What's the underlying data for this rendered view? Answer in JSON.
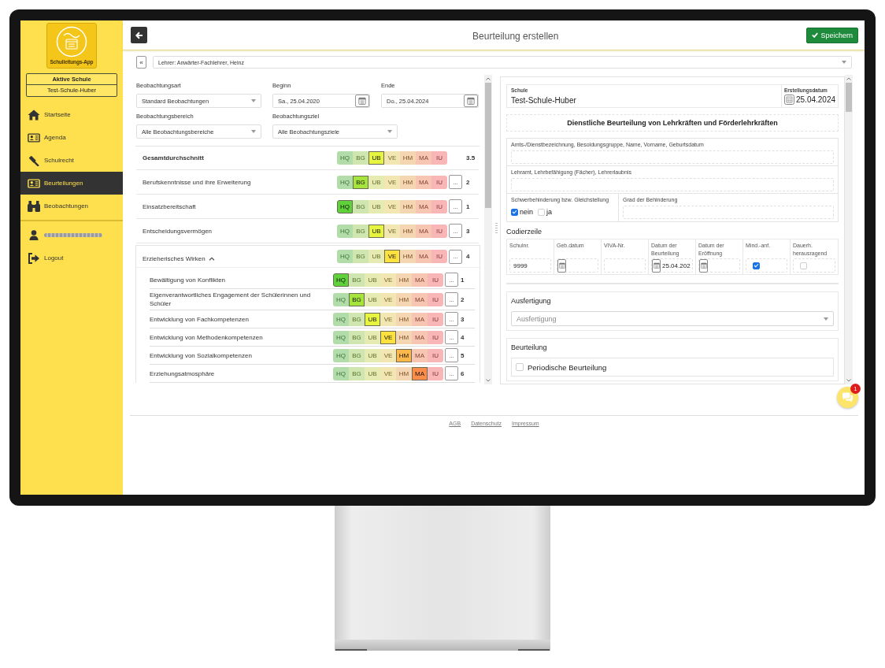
{
  "sidebar": {
    "logo_caption": "Schulleitungs-App",
    "active_school": {
      "heading": "Aktive Schule",
      "name": "Test-Schule-Huber"
    },
    "nav": [
      {
        "label": "Startseite",
        "selected": false
      },
      {
        "label": "Agenda",
        "selected": false
      },
      {
        "label": "Schulrecht",
        "selected": false
      },
      {
        "label": "Beurteilungen",
        "selected": true
      },
      {
        "label": "Beobachtungen",
        "selected": false
      }
    ],
    "logout": "Logout"
  },
  "topbar": {
    "title": "Beurteilung erstellen",
    "save_button": "Speichern"
  },
  "teacher_bar": {
    "collapse_button": "«",
    "teacher": "Lehrer: Anwärter-Fachlehrer, Heinz"
  },
  "filter_rows": [
    {
      "fields": [
        {
          "kind": "select",
          "label": "Beobachtungsart",
          "value": "Standard Beobachtungen"
        },
        {
          "kind": "date",
          "label": "Beginn",
          "value": "Sa., 25.04.2020"
        },
        {
          "kind": "date",
          "label": "Ende",
          "value": "Do., 25.04.2024"
        }
      ]
    },
    {
      "fields": [
        {
          "kind": "select",
          "label": "Beobachtungsbereich",
          "value": "Alle Beobachtungsbereiche"
        },
        {
          "kind": "select",
          "label": "Beobachtungsziel",
          "value": "Alle Beobachtungsziele"
        }
      ]
    }
  ],
  "ratings": [
    {
      "kind": "average",
      "label": "Gesamtdurchschnitt",
      "grades": [
        {
          "label": "HQ",
          "selected": false
        },
        {
          "label": "BG",
          "selected": false
        },
        {
          "label": "UB",
          "selected": true
        },
        {
          "label": "VE",
          "selected": false
        },
        {
          "label": "HM",
          "selected": false
        },
        {
          "label": "MA",
          "selected": false
        },
        {
          "label": "IU",
          "selected": false
        }
      ],
      "value": "3.5"
    },
    {
      "kind": "criterion",
      "label": "Berufskenntnisse und ihre Erweiterung",
      "grades": [
        {
          "label": "HQ",
          "selected": false
        },
        {
          "label": "BG",
          "selected": true
        },
        {
          "label": "UB",
          "selected": false
        },
        {
          "label": "VE",
          "selected": false
        },
        {
          "label": "HM",
          "selected": false
        },
        {
          "label": "MA",
          "selected": false
        },
        {
          "label": "IU",
          "selected": false
        }
      ],
      "more": "...",
      "value": "2"
    },
    {
      "kind": "criterion",
      "label": "Einsatzbereitschaft",
      "grades": [
        {
          "label": "HQ",
          "selected": true
        },
        {
          "label": "BG",
          "selected": false
        },
        {
          "label": "UB",
          "selected": false
        },
        {
          "label": "VE",
          "selected": false
        },
        {
          "label": "HM",
          "selected": false
        },
        {
          "label": "MA",
          "selected": false
        },
        {
          "label": "IU",
          "selected": false
        }
      ],
      "more": "...",
      "value": "1"
    },
    {
      "kind": "criterion",
      "label": "Entscheidungsvermögen",
      "grades": [
        {
          "label": "HQ",
          "selected": false
        },
        {
          "label": "BG",
          "selected": false
        },
        {
          "label": "UB",
          "selected": true
        },
        {
          "label": "VE",
          "selected": false
        },
        {
          "label": "HM",
          "selected": false
        },
        {
          "label": "MA",
          "selected": false
        },
        {
          "label": "IU",
          "selected": false
        }
      ],
      "more": "...",
      "value": "3"
    },
    {
      "kind": "group",
      "label": "Erzieherisches Wirken",
      "expanded": true,
      "grades": [
        {
          "label": "HQ",
          "selected": false
        },
        {
          "label": "BG",
          "selected": false
        },
        {
          "label": "UB",
          "selected": false
        },
        {
          "label": "VE",
          "selected": true
        },
        {
          "label": "HM",
          "selected": false
        },
        {
          "label": "MA",
          "selected": false
        },
        {
          "label": "IU",
          "selected": false
        }
      ],
      "more": "...",
      "value": "4",
      "children": [
        {
          "kind": "criterion",
          "label": "Bewältigung von Konflikten",
          "grades": [
            {
              "label": "HQ",
              "selected": true
            },
            {
              "label": "BG",
              "selected": false
            },
            {
              "label": "UB",
              "selected": false
            },
            {
              "label": "VE",
              "selected": false
            },
            {
              "label": "HM",
              "selected": false
            },
            {
              "label": "MA",
              "selected": false
            },
            {
              "label": "IU",
              "selected": false
            }
          ],
          "more": "...",
          "value": "1"
        },
        {
          "kind": "criterion",
          "label": "Eigenverantwortliches Engagement der Schülerinnen und Schüler",
          "grades": [
            {
              "label": "HQ",
              "selected": false
            },
            {
              "label": "BG",
              "selected": true
            },
            {
              "label": "UB",
              "selected": false
            },
            {
              "label": "VE",
              "selected": false
            },
            {
              "label": "HM",
              "selected": false
            },
            {
              "label": "MA",
              "selected": false
            },
            {
              "label": "IU",
              "selected": false
            }
          ],
          "more": "...",
          "value": "2"
        },
        {
          "kind": "criterion",
          "label": "Entwicklung von Fachkompetenzen",
          "grades": [
            {
              "label": "HQ",
              "selected": false
            },
            {
              "label": "BG",
              "selected": false
            },
            {
              "label": "UB",
              "selected": true
            },
            {
              "label": "VE",
              "selected": false
            },
            {
              "label": "HM",
              "selected": false
            },
            {
              "label": "MA",
              "selected": false
            },
            {
              "label": "IU",
              "selected": false
            }
          ],
          "more": "...",
          "value": "3"
        },
        {
          "kind": "criterion",
          "label": "Entwicklung von Methodenkompetenzen",
          "grades": [
            {
              "label": "HQ",
              "selected": false
            },
            {
              "label": "BG",
              "selected": false
            },
            {
              "label": "UB",
              "selected": false
            },
            {
              "label": "VE",
              "selected": true
            },
            {
              "label": "HM",
              "selected": false
            },
            {
              "label": "MA",
              "selected": false
            },
            {
              "label": "IU",
              "selected": false
            }
          ],
          "more": "...",
          "value": "4"
        },
        {
          "kind": "criterion",
          "label": "Entwicklung von Sozialkompetenzen",
          "grades": [
            {
              "label": "HQ",
              "selected": false
            },
            {
              "label": "BG",
              "selected": false
            },
            {
              "label": "UB",
              "selected": false
            },
            {
              "label": "VE",
              "selected": false
            },
            {
              "label": "HM",
              "selected": true
            },
            {
              "label": "MA",
              "selected": false
            },
            {
              "label": "IU",
              "selected": false
            }
          ],
          "more": "...",
          "value": "5"
        },
        {
          "kind": "criterion",
          "label": "Erziehungsatmosphäre",
          "grades": [
            {
              "label": "HQ",
              "selected": false
            },
            {
              "label": "BG",
              "selected": false
            },
            {
              "label": "UB",
              "selected": false
            },
            {
              "label": "VE",
              "selected": false
            },
            {
              "label": "HM",
              "selected": false
            },
            {
              "label": "MA",
              "selected": true
            },
            {
              "label": "IU",
              "selected": false
            }
          ],
          "more": "...",
          "value": "6"
        }
      ]
    }
  ],
  "report": {
    "school": {
      "label": "Schule",
      "value": "Test-Schule-Huber"
    },
    "created": {
      "label": "Erstellungsdatum",
      "value": "25.04.2024"
    },
    "title": "Dienstliche Beurteilung von Lehrkräften und Förderlehrkräften",
    "fields": [
      {
        "label": "Amts-/Dienstbezeichnung, Besoldungsgruppe, Name, Vorname, Geburtsdatum"
      },
      {
        "label": "Lehramt, Lehrbefähigung (Fächer), Lehrerlaubnis"
      }
    ],
    "disability": {
      "label": "Schwerbehinderung bzw. Gleichstellung",
      "options": [
        {
          "label": "nein",
          "checked": true
        },
        {
          "label": "ja",
          "checked": false
        }
      ],
      "degree_label": "Grad der Behinderung"
    },
    "coding": {
      "heading": "Codierzeile",
      "columns": [
        {
          "kind": "text",
          "label": "Schulnr.",
          "value": "9999"
        },
        {
          "kind": "date",
          "label": "Geb.datum"
        },
        {
          "kind": "text",
          "label": "VIVA-Nr."
        },
        {
          "kind": "date",
          "label": "Datum der Beurteilung",
          "value": "25.04.202"
        },
        {
          "kind": "date",
          "label": "Datum der Eröffnung"
        },
        {
          "kind": "checkbox",
          "label": "Mind.-anf.",
          "checked": true
        },
        {
          "kind": "checkbox",
          "label": "Dauerh. herausragend",
          "checked": false
        }
      ]
    },
    "execution": {
      "heading": "Ausfertigung",
      "placeholder": "Ausfertigung"
    },
    "assessment": {
      "heading": "Beurteilung",
      "options": [
        {
          "label": "Periodische Beurteilung",
          "checked": false
        }
      ]
    }
  },
  "chat": {
    "badge": "1"
  },
  "footer": {
    "links": [
      "AGB",
      "Datenschutz",
      "Impressum"
    ]
  }
}
